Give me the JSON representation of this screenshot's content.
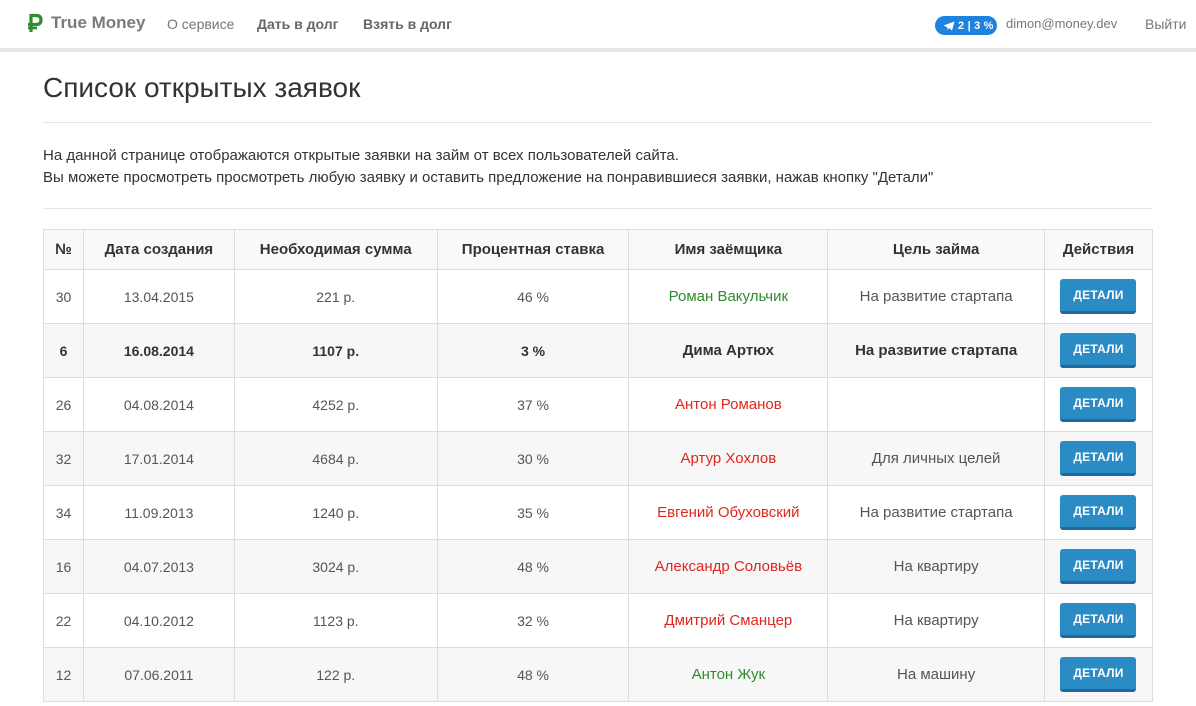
{
  "brand": {
    "name": "True Money"
  },
  "nav": {
    "about": "О сервисе",
    "lend": "Дать в долг",
    "borrow": "Взять в долг",
    "badge": "2 | 3 %",
    "email": "dimon@money.dev",
    "logout": "Выйти"
  },
  "page": {
    "title": "Список открытых заявок",
    "intro_line1": "На данной странице отображаются открытые заявки на займ от всех пользователей сайта.",
    "intro_line2": "Вы можете просмотреть просмотреть любую заявку и оставить предложение на понравившиеся заявки, нажав кнопку \"Детали\""
  },
  "table": {
    "headers": [
      "№",
      "Дата создания",
      "Необходимая сумма",
      "Процентная ставка",
      "Имя заёмщика",
      "Цель займа",
      "Действия"
    ],
    "button_label": "ДЕТАЛИ",
    "rows": [
      {
        "id": "30",
        "date": "13.04.2015",
        "amount": "221 р.",
        "rate": "46 %",
        "name": "Роман Вакульчик",
        "purpose": "На развитие стартапа"
      },
      {
        "id": "6",
        "date": "16.08.2014",
        "amount": "1107 р.",
        "rate": "3 %",
        "name": "Дима Артюх",
        "purpose": "На развитие стартапа"
      },
      {
        "id": "26",
        "date": "04.08.2014",
        "amount": "4252 р.",
        "rate": "37 %",
        "name": "Антон Романов",
        "purpose": ""
      },
      {
        "id": "32",
        "date": "17.01.2014",
        "amount": "4684 р.",
        "rate": "30 %",
        "name": "Артур Хохлов",
        "purpose": "Для личных целей"
      },
      {
        "id": "34",
        "date": "11.09.2013",
        "amount": "1240 р.",
        "rate": "35 %",
        "name": "Евгений Обуховский",
        "purpose": "На развитие стартапа"
      },
      {
        "id": "16",
        "date": "04.07.2013",
        "amount": "3024 р.",
        "rate": "48 %",
        "name": "Александр Соловьёв",
        "purpose": "На квартиру"
      },
      {
        "id": "22",
        "date": "04.10.2012",
        "amount": "1123 р.",
        "rate": "32 %",
        "name": "Дмитрий Сманцер",
        "purpose": "На квартиру"
      },
      {
        "id": "12",
        "date": "07.06.2011",
        "amount": "122 р.",
        "rate": "48 %",
        "name": "Антон Жук",
        "purpose": "На машину"
      }
    ]
  },
  "colors": {
    "green": "#2e8b2e",
    "red": "#e0261e",
    "button": "#2a8bc5",
    "badge": "#1e82e0"
  }
}
